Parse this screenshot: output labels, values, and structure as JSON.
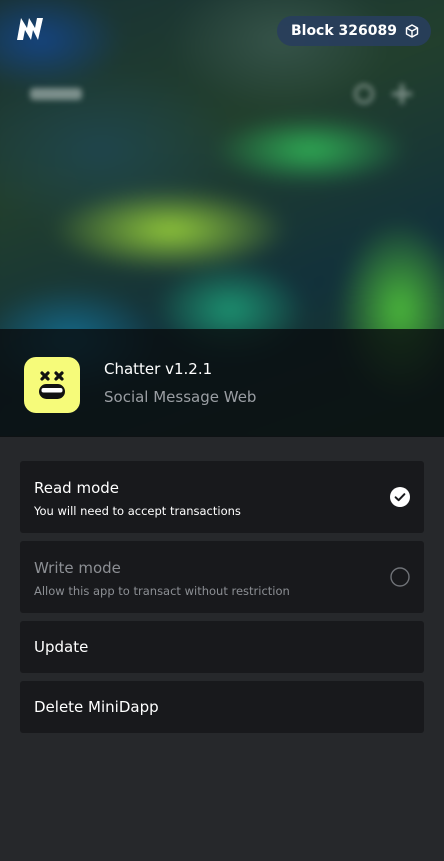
{
  "header": {
    "block_label": "Block 326089",
    "logo_icon": "minima-logo-icon",
    "block_icon": "cube-icon"
  },
  "app": {
    "name": "Chatter v1.2.1",
    "description": "Social Message Web",
    "icon": "dizzy-face-icon",
    "icon_bg": "#f6fb7a"
  },
  "options": [
    {
      "title": "Read mode",
      "subtitle": "You will need to accept transactions",
      "selected": true
    },
    {
      "title": "Write mode",
      "subtitle": "Allow this app to transact without restriction",
      "selected": false
    },
    {
      "title": "Update"
    },
    {
      "title": "Delete MiniDapp"
    }
  ],
  "colors": {
    "background": "#26282b",
    "card": "#18191c",
    "badge": "#283e5c"
  }
}
